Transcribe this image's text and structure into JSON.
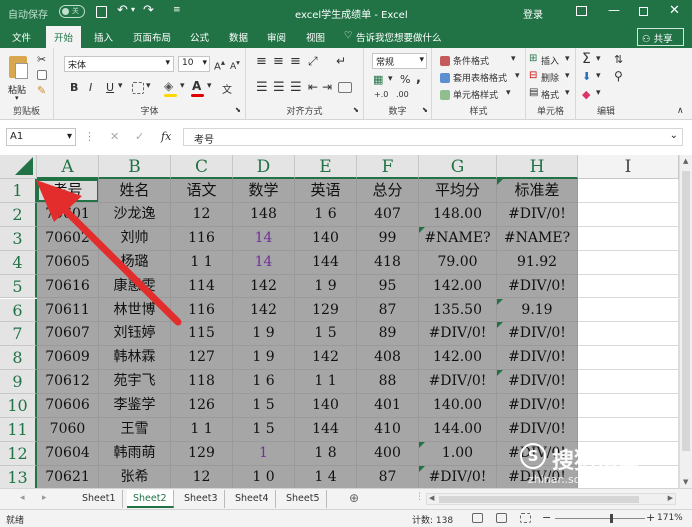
{
  "titlebar": {
    "autosave": "自动保存",
    "autosave_state": "关",
    "title": "excel学生成绩单 - Excel",
    "login": "登录"
  },
  "ribbon_tabs": [
    "文件",
    "开始",
    "插入",
    "页面布局",
    "公式",
    "数据",
    "审阅",
    "视图"
  ],
  "tell_me": "告诉我您想要做什么",
  "share": "共享",
  "ribbon": {
    "clipboard": {
      "paste": "粘贴",
      "label": "剪贴板"
    },
    "font": {
      "name": "宋体",
      "size": "10",
      "bold": "B",
      "italic": "I",
      "underline": "U",
      "label": "字体"
    },
    "alignment": {
      "label": "对齐方式"
    },
    "number": {
      "format": "常规",
      "percent": "%",
      "comma": ",",
      "label": "数字"
    },
    "styles": {
      "conditional": "条件格式",
      "table": "套用表格格式",
      "cell_styles": "单元格样式",
      "label": "样式"
    },
    "cells": {
      "insert": "插入",
      "delete": "删除",
      "format": "格式",
      "label": "单元格"
    },
    "editing": {
      "label": "编辑"
    }
  },
  "formula_bar": {
    "name_box": "A1",
    "fx": "fx",
    "value": "考号"
  },
  "columns": [
    "A",
    "B",
    "C",
    "D",
    "E",
    "F",
    "G",
    "H",
    "I"
  ],
  "rows": [
    "1",
    "2",
    "3",
    "4",
    "5",
    "6",
    "7",
    "8",
    "9",
    "10",
    "11",
    "12",
    "13"
  ],
  "cells": [
    [
      "考号",
      "姓名",
      "语文",
      "数学",
      "英语",
      "总分",
      "平均分",
      "标准差"
    ],
    [
      "70601",
      "沙龙逸",
      "12",
      "148",
      "1 6",
      "407",
      "148.00",
      "#DIV/0!"
    ],
    [
      "70602",
      "刘帅",
      "116",
      "14",
      "140",
      "99",
      "#NAME?",
      "#NAME?"
    ],
    [
      "70605",
      "杨璐",
      "1 1",
      "14",
      "144",
      "418",
      "79.00",
      "91.92"
    ],
    [
      "70616",
      "康惠雯",
      "114",
      "142",
      "1 9",
      "95",
      "142.00",
      "#DIV/0!"
    ],
    [
      "70611",
      "林世博",
      "116",
      "142",
      "129",
      "87",
      "135.50",
      "9.19"
    ],
    [
      "70607",
      "刘钰婷",
      "115",
      "1 9",
      "1 5",
      "89",
      "#DIV/0!",
      "#DIV/0!"
    ],
    [
      "70609",
      "韩林霖",
      "127",
      "1 9",
      "142",
      "408",
      "142.00",
      "#DIV/0!"
    ],
    [
      "70612",
      "苑宇飞",
      "118",
      "1 6",
      "1 1",
      "88",
      "#DIV/0!",
      "#DIV/0!"
    ],
    [
      "70606",
      "李鉴学",
      "126",
      "1 5",
      "140",
      "401",
      "140.00",
      "#DIV/0!"
    ],
    [
      "7060",
      "王雪",
      "1 1",
      "1 5",
      "144",
      "410",
      "144.00",
      "#DIV/0!"
    ],
    [
      "70604",
      "韩雨萌",
      "129",
      "1",
      "1 8",
      "400",
      "1.00",
      "#DIV/0!"
    ],
    [
      "70621",
      "张希",
      "12",
      "1 0",
      "1 4",
      "87",
      "#DIV/0!",
      "#DIV/0!"
    ]
  ],
  "sheets": [
    "Sheet1",
    "Sheet2",
    "Sheet3",
    "Sheet4",
    "Sheet5"
  ],
  "active_sheet": "Sheet2",
  "status": {
    "mode": "就绪",
    "count": "计数: 138",
    "zoom": "171%"
  },
  "watermark": {
    "brand": "搜狗指南",
    "url": "zhinan.sogou.com"
  },
  "colors": {
    "excel_green": "#217346",
    "selection": "#a6a6a6",
    "arrow": "#e32d2d",
    "purple_text": "#7030a0"
  }
}
